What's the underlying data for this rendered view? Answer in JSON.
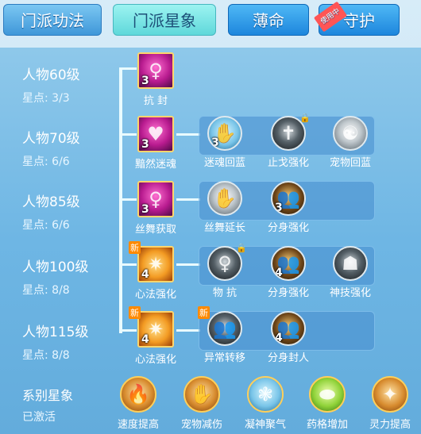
{
  "tabs": [
    {
      "label": "门派功法"
    },
    {
      "label": "门派星象"
    },
    {
      "label": "薄命"
    },
    {
      "label": "守护",
      "badge": "使用中"
    }
  ],
  "rows": [
    {
      "level": "人物60级",
      "points": "星点: 3/3",
      "skills": [
        {
          "name": "抗 封",
          "count": "3",
          "icon": "dancer-silhouette-icon"
        }
      ]
    },
    {
      "level": "人物70级",
      "points": "星点: 6/6",
      "skills": [
        {
          "name": "黯然迷魂",
          "count": "3",
          "icon": "heart-swirl-icon"
        },
        {
          "name": "迷魂回蓝",
          "count": "3",
          "icon": "mana-hand-icon"
        },
        {
          "name": "止戈强化",
          "count": "",
          "icon": "cross-stake-icon",
          "locked": true
        },
        {
          "name": "宠物回蓝",
          "count": "",
          "icon": "pet-recall-icon"
        }
      ]
    },
    {
      "level": "人物85级",
      "points": "星点: 6/6",
      "skills": [
        {
          "name": "丝舞获取",
          "count": "3",
          "icon": "silk-dance-icon"
        },
        {
          "name": "丝舞延长",
          "count": "",
          "icon": "hands-icon"
        },
        {
          "name": "分身强化",
          "count": "3",
          "icon": "twin-silhouette-icon"
        }
      ]
    },
    {
      "level": "人物100级",
      "points": "星点: 8/8",
      "skills": [
        {
          "name": "心法强化",
          "count": "4",
          "icon": "spider-icon",
          "isNew": true
        },
        {
          "name": "物 抗",
          "count": "",
          "icon": "dancer-silhouette-icon",
          "locked": true
        },
        {
          "name": "分身强化",
          "count": "4",
          "icon": "twin-silhouette-icon"
        },
        {
          "name": "神技强化",
          "count": "",
          "icon": "beast-icon"
        }
      ]
    },
    {
      "level": "人物115级",
      "points": "星点: 8/8",
      "skills": [
        {
          "name": "心法强化",
          "count": "4",
          "icon": "spider-icon",
          "isNew": true
        },
        {
          "name": "异常转移",
          "count": "",
          "icon": "swap-figures-icon",
          "isNew": true
        },
        {
          "name": "分身封人",
          "count": "4",
          "icon": "twin-silhouette-icon"
        }
      ]
    }
  ],
  "series": {
    "title": "系别星象",
    "status": "已激活",
    "items": [
      {
        "name": "速度提高",
        "icon": "speed-flame-icon"
      },
      {
        "name": "宠物减伤",
        "icon": "pet-shield-icon"
      },
      {
        "name": "凝神聚气",
        "icon": "meditation-icon"
      },
      {
        "name": "药格增加",
        "icon": "potion-icon"
      },
      {
        "name": "灵力提高",
        "icon": "spirit-power-icon"
      }
    ]
  },
  "new_label": "新",
  "lock_glyph": "🔒"
}
